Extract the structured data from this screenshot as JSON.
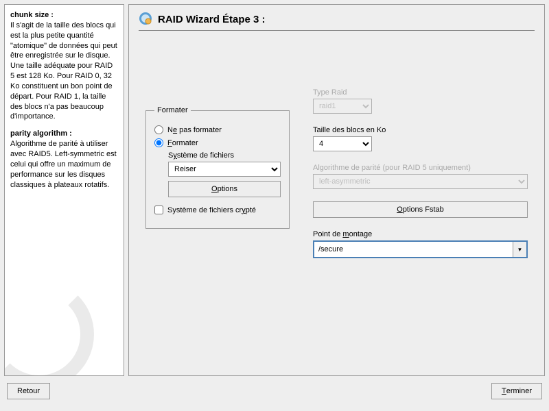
{
  "sidebar": {
    "chunk_heading": "chunk size :",
    "chunk_text": "Il s'agit de la taille des blocs qui est la plus petite quantité \"atomique\" de données qui peut être enregistrée sur le disque. Une taille adéquate pour RAID 5 est 128 Ko. Pour RAID 0, 32 Ko constituent un bon point de départ. Pour RAID 1, la taille des blocs n'a pas beaucoup d'importance.",
    "parity_heading": "parity algorithm :",
    "parity_text": "Algorithme de parité à utiliser avec RAID5. Left-symmetric est celui qui offre un maximum de performance sur les disques classiques à plateaux rotatifs."
  },
  "title": "RAID Wizard Étape 3 :",
  "format_group": {
    "legend": "Formater",
    "no_format_pre": "N",
    "no_format_u": "e",
    "no_format_post": " pas formater",
    "format_u": "F",
    "format_post": "ormater",
    "fs_pre": "S",
    "fs_u": "y",
    "fs_post": "stème de fichiers",
    "fs_value": "Reiser",
    "options_u": "O",
    "options_post": "ptions",
    "crypt_pre": "Système de fichiers cr",
    "crypt_u": "y",
    "crypt_post": "pté"
  },
  "right": {
    "type_label": "Type Raid",
    "type_value": "raid1",
    "block_label": "Taille des blocs en Ko",
    "block_value": "4",
    "parity_label": "Algorithme de parité (pour RAID 5 uniquement)",
    "parity_value": "left-asymmetric",
    "fstab_u": "O",
    "fstab_post": "ptions Fstab",
    "mount_pre": "Point de ",
    "mount_u": "m",
    "mount_post": "ontage",
    "mount_value": "/secure"
  },
  "buttons": {
    "back": "Retour",
    "finish_u": "T",
    "finish_post": "erminer"
  }
}
